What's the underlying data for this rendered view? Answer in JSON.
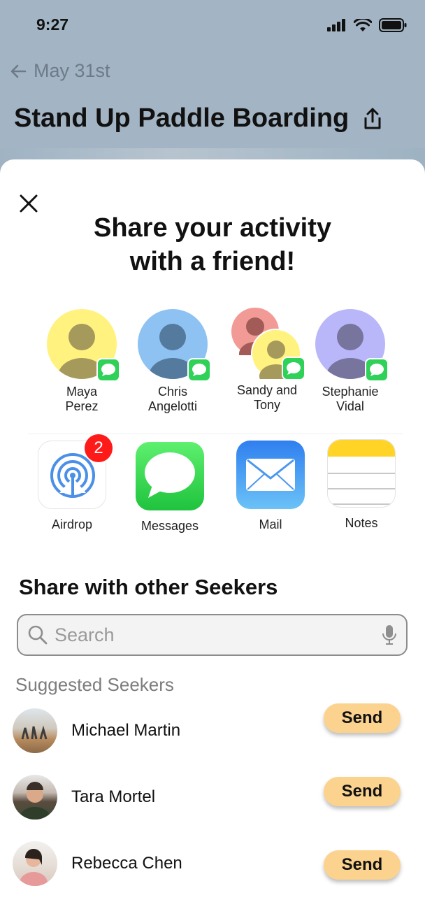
{
  "status_bar": {
    "time": "9:27"
  },
  "header": {
    "back_label": "May 31st",
    "title": "Stand Up Paddle Boarding"
  },
  "share_sheet": {
    "title_line1": "Share your activity",
    "title_line2": "with a friend!",
    "contacts": [
      {
        "name_line1": "Maya",
        "name_line2": "Perez"
      },
      {
        "name_line1": "Chris",
        "name_line2": "Angelotti"
      },
      {
        "name_line1": "Sandy and",
        "name_line2": "Tony"
      },
      {
        "name_line1": "Stephanie",
        "name_line2": "Vidal"
      }
    ],
    "apps": [
      {
        "label": "Airdrop",
        "badge": "2"
      },
      {
        "label": "Messages"
      },
      {
        "label": "Mail"
      },
      {
        "label": "Notes"
      }
    ]
  },
  "seekers": {
    "heading": "Share with other Seekers",
    "search_placeholder": "Search",
    "suggested_label": "Suggested Seekers",
    "send_label": "Send",
    "items": [
      {
        "name": "Michael Martin"
      },
      {
        "name": "Tara Mortel"
      },
      {
        "name": "Rebecca Chen"
      }
    ]
  },
  "colors": {
    "accent_send": "#fbd38f",
    "messages_green": "#2fd158",
    "badge_red": "#ff1a1a",
    "background_blue": "#a3b4c4"
  }
}
